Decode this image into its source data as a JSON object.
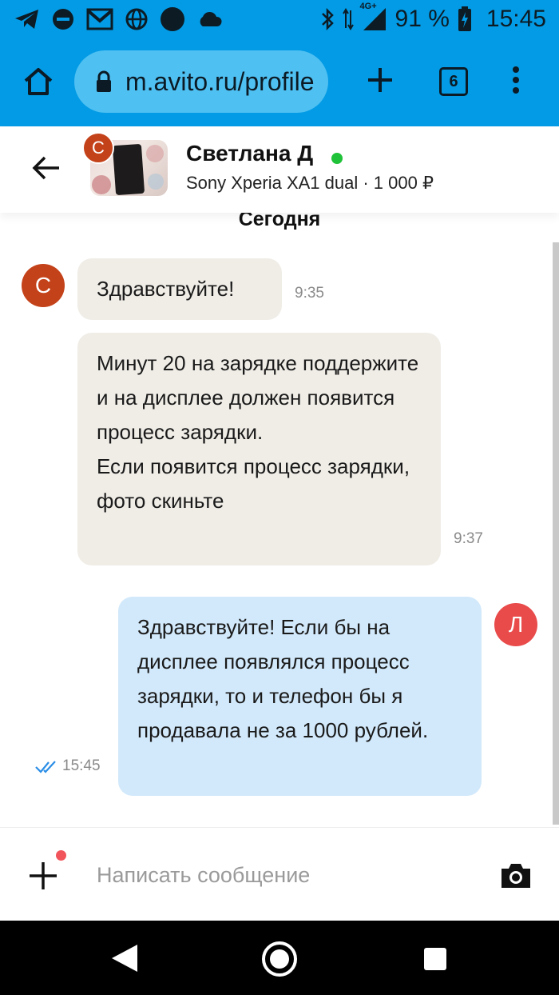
{
  "status_bar": {
    "battery_percent": "91 %",
    "network": "4G+",
    "time": "15:45",
    "icons_left": [
      "telegram-icon",
      "do-not-disturb-icon",
      "gmail-icon",
      "globe-icon",
      "circle-icon",
      "cloud-icon"
    ],
    "icons_right": [
      "bluetooth-icon",
      "data-arrows-icon",
      "signal-icon",
      "battery-charging-icon"
    ]
  },
  "browser": {
    "url": "m.avito.ru/profile",
    "tab_count": "6"
  },
  "chat_header": {
    "seller_name": "Светлана Д",
    "seller_initial": "С",
    "online": true,
    "item_line": "Sony Xperia XA1 dual · 1 000 ₽"
  },
  "messages": {
    "date_separator": "Сегодня",
    "list": [
      {
        "direction": "incoming",
        "text": "Здравствуйте!",
        "time": "9:35"
      },
      {
        "direction": "incoming",
        "text": "Минут 20 на зарядке поддержите и на дисплее должен появится процесс зарядки.\nЕсли появится процесс зарядки, фото скиньте",
        "time": "9:37"
      },
      {
        "direction": "outgoing",
        "text": "Здравствуйте! Если бы на дисплее появлялся процесс зарядки, то и телефон бы я продавала не за 1000 рублей.",
        "time": "15:45",
        "status": "read"
      }
    ],
    "own_initial": "Л"
  },
  "composer": {
    "placeholder": "Написать сообщение",
    "value": ""
  },
  "colors": {
    "browser_bar": "#039be5",
    "incoming_bubble": "#f0ede7",
    "outgoing_bubble": "#d2e9fb",
    "seller_avatar": "#c4421a",
    "own_avatar": "#e94b4b",
    "online": "#1fc238",
    "read_check": "#2b8ee6"
  }
}
